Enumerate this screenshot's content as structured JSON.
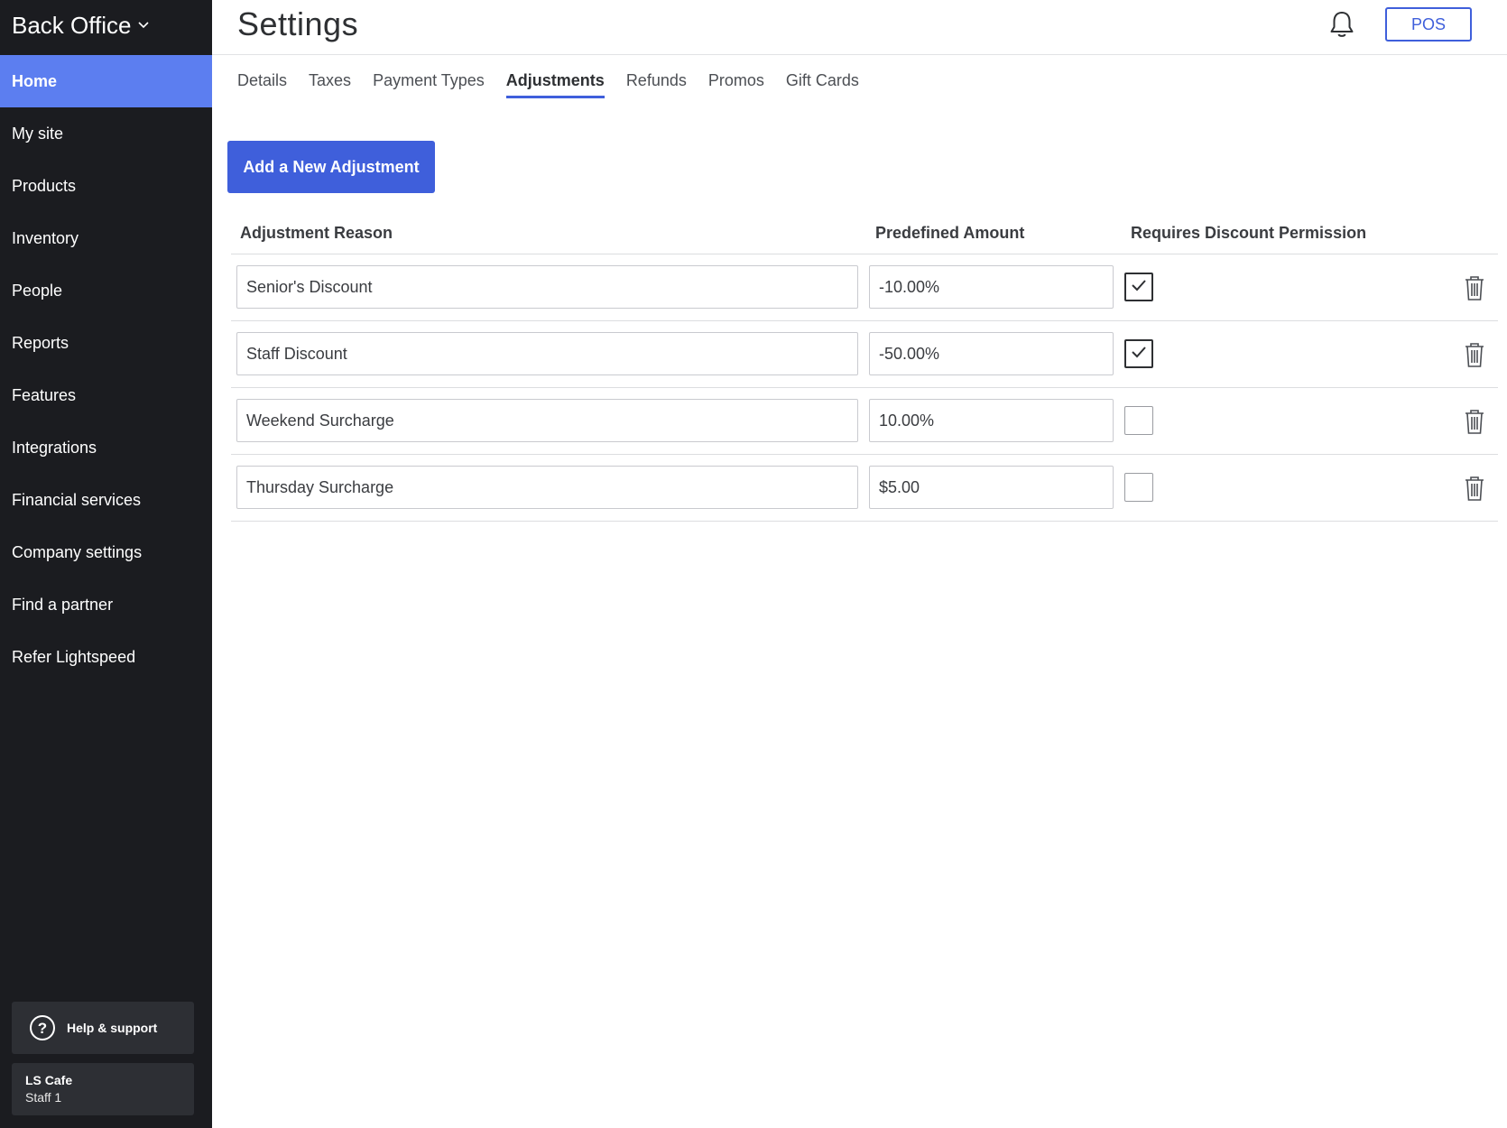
{
  "sidebar": {
    "brand": "Back Office",
    "items": [
      {
        "label": "Home",
        "active": true
      },
      {
        "label": "My site"
      },
      {
        "label": "Products"
      },
      {
        "label": "Inventory"
      },
      {
        "label": "People"
      },
      {
        "label": "Reports"
      },
      {
        "label": "Features"
      },
      {
        "label": "Integrations"
      },
      {
        "label": "Financial services"
      },
      {
        "label": "Company settings"
      },
      {
        "label": "Find a partner"
      },
      {
        "label": "Refer Lightspeed"
      }
    ],
    "help_label": "Help & support",
    "account": {
      "name": "LS Cafe",
      "role": "Staff 1"
    }
  },
  "header": {
    "title": "Settings",
    "pos_label": "POS",
    "icons": {
      "notification": "bell-icon"
    }
  },
  "tabs": [
    {
      "label": "Details"
    },
    {
      "label": "Taxes"
    },
    {
      "label": "Payment Types"
    },
    {
      "label": "Adjustments",
      "active": true
    },
    {
      "label": "Refunds"
    },
    {
      "label": "Promos"
    },
    {
      "label": "Gift Cards"
    }
  ],
  "add_button_label": "Add a New Adjustment",
  "table": {
    "columns": [
      "Adjustment Reason",
      "Predefined Amount",
      "Requires Discount Permission"
    ],
    "rows": [
      {
        "reason": "Senior's Discount",
        "amount": "-10.00%",
        "requires_permission": true
      },
      {
        "reason": "Staff Discount",
        "amount": "-50.00%",
        "requires_permission": true
      },
      {
        "reason": "Weekend Surcharge",
        "amount": "10.00%",
        "requires_permission": false
      },
      {
        "reason": "Thursday Surcharge",
        "amount": "$5.00",
        "requires_permission": false
      }
    ]
  },
  "colors": {
    "sidebar_bg": "#1b1c20",
    "active_nav": "#5c7ef0",
    "accent": "#3f5fdb"
  }
}
